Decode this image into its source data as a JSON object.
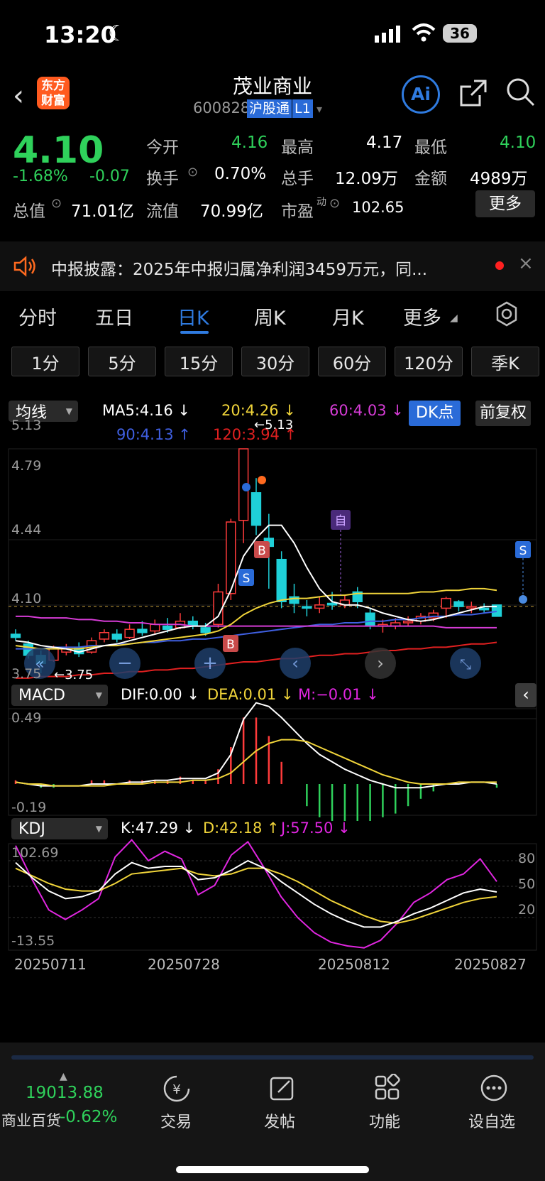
{
  "status": {
    "time": "13:20",
    "battery": "36"
  },
  "nav": {
    "title": "茂业商业",
    "code": "600828",
    "badge1": "沪股通",
    "badge2": "L1",
    "logo": "东方财富",
    "ai": "Ai"
  },
  "quote": {
    "price": "4.10",
    "pct": "-1.68%",
    "chg": "-0.07",
    "open_l": "今开",
    "open": "4.16",
    "high_l": "最高",
    "high": "4.17",
    "low_l": "最低",
    "low": "4.10",
    "turn_l": "换手",
    "turn": "0.70%",
    "vol_l": "总手",
    "vol": "12.09万",
    "amt_l": "金额",
    "amt": "4989万",
    "mcap_l": "总值",
    "mcap": "71.01亿",
    "float_l": "流值",
    "float": "70.99亿",
    "pe_l": "市盈",
    "pe_sup": "动",
    "pe": "102.65",
    "more": "更多"
  },
  "notice": {
    "text": "中报披露：2025年中报归属净利润3459万元，同..."
  },
  "tabs": [
    "分时",
    "五日",
    "日K",
    "周K",
    "月K",
    "更多",
    "设置"
  ],
  "periods": [
    "1分",
    "5分",
    "15分",
    "30分",
    "60分",
    "120分",
    "季K"
  ],
  "ma": {
    "sel": "均线",
    "ma5": "MA5:4.16 ↓",
    "ma20": "20:4.26 ↓",
    "ma60": "60:4.03 ↓",
    "ma90": "90:4.13 ↑",
    "ma120": "120:3.94 ↑",
    "dk": "DK点",
    "fq": "前复权"
  },
  "price_axis": [
    "5.13",
    "4.79",
    "4.44",
    "4.10",
    "3.75"
  ],
  "price_marks": {
    "hi": "←5.13",
    "lo": "←3.75",
    "self": "自"
  },
  "macd": {
    "sel": "MACD",
    "dif": "DIF:0.00 ↓",
    "dea": "DEA:0.01 ↓",
    "m": "M:−0.01 ↓",
    "top": "0.49",
    "bot": "-0.19"
  },
  "kdj": {
    "sel": "KDJ",
    "k": "K:47.29 ↓",
    "d": "D:42.18 ↑",
    "j": "J:57.50 ↓",
    "top": "102.69",
    "bot": "-13.55",
    "r80": "80",
    "r50": "50",
    "r20": "20"
  },
  "dates": [
    "20250711",
    "20250728",
    "20250812",
    "20250827"
  ],
  "bottom": {
    "index": "19013.88",
    "sector": "商业百货",
    "sector_pct": "-0.62%",
    "trade": "交易",
    "post": "发帖",
    "func": "功能",
    "watch": "设自选"
  },
  "colors": {
    "up": "#ff3b3b",
    "down": "#2fd15b",
    "ma5": "#ffffff",
    "ma20": "#f0d43a",
    "ma60": "#d63cd6",
    "ma90": "#3f5fe0",
    "ma120": "#e02020",
    "accent": "#3a7bd5"
  }
}
